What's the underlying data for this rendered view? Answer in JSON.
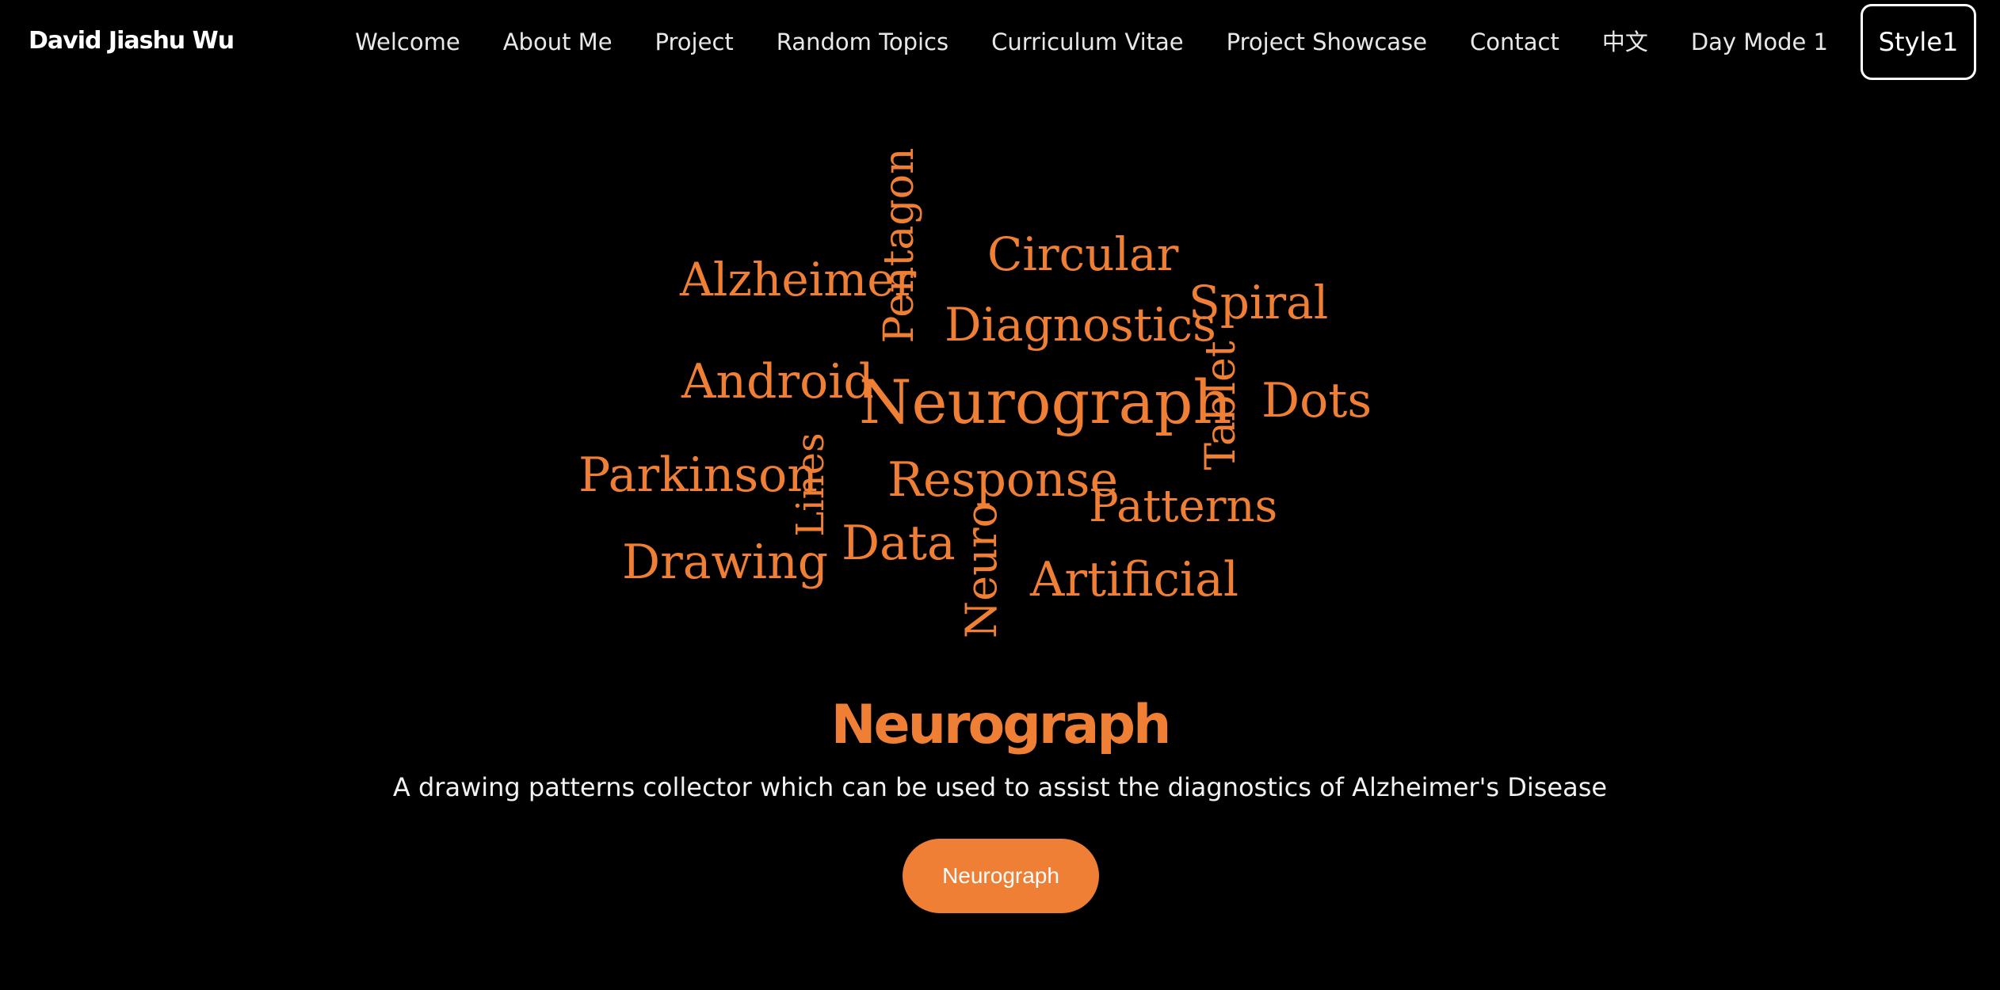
{
  "colors": {
    "background": "#000000",
    "accent": "#ef7f35",
    "text": "#ffffff"
  },
  "navbar": {
    "brand": "David Jiashu Wu",
    "items": [
      {
        "label": "Welcome"
      },
      {
        "label": "About Me"
      },
      {
        "label": "Project"
      },
      {
        "label": "Random Topics"
      },
      {
        "label": "Curriculum Vitae"
      },
      {
        "label": "Project Showcase"
      },
      {
        "label": "Contact"
      },
      {
        "label": "中文"
      },
      {
        "label": "Day Mode 1"
      }
    ],
    "style_button": "Style1"
  },
  "word_cloud": {
    "words": [
      "Pentagon",
      "Circular",
      "Alzheimer",
      "Spiral",
      "Diagnostics",
      "Android",
      "Neurograph",
      "Tablet",
      "Dots",
      "Parkinson",
      "Lines",
      "Response",
      "Patterns",
      "Drawing",
      "Data",
      "Neuro",
      "Artificial"
    ]
  },
  "hero": {
    "title": "Neurograph",
    "subtitle": "A drawing patterns collector which can be used to assist the diagnostics of Alzheimer's Disease",
    "button_label": "Neurograph"
  }
}
